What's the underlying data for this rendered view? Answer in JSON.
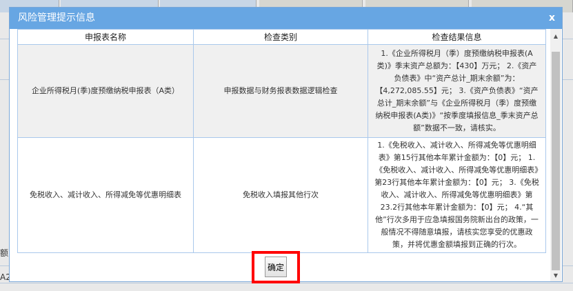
{
  "dialog": {
    "title": "风险管理提示信息",
    "close_label": "x",
    "confirm_label": "确定"
  },
  "table": {
    "headers": [
      "申报表名称",
      "检查类别",
      "检查结果信息"
    ],
    "rows": [
      {
        "name": "企业所得税月(季)度预缴纳税申报表（A类）",
        "category": "申报数据与财务报表数据逻辑检查",
        "result": "1.《企业所得税月（季）度预缴纳税申报表(A类)》季末资产总额为：【430】万元； 2.《资产负债表》中“资产总计_期末余额”为：【4,272,085.55】元； 3.《资产负债表》“资产总计_期末余额”与《企业所得税月（季）度预缴纳税申报表(A类)》“按季度填报信息_季末资产总额”数据不一致，请核实。"
      },
      {
        "name": "免税收入、减计收入、所得减免等优惠明细表",
        "category": "免税收入填报其他行次",
        "result": "1.《免税收入、减计收入、所得减免等优惠明细表》第15行其他本年累计金额为：【0】元； 1.《免税收入、减计收入、所得减免等优惠明细表》第23行其他本年累计金额为：【0】元； 3.《免税收入、减计收入、所得减免等优惠明细表》第23.2行其他本年累计金额为：【0】元； 4.“其他”行次多用于应急填报国务院新出台的政策，一般情况不得随意填报，请核实您享受的优惠政策，并将优惠金额填报到正确的行次。"
      }
    ]
  },
  "background": {
    "left_fragments": [
      "额",
      "A2"
    ]
  }
}
